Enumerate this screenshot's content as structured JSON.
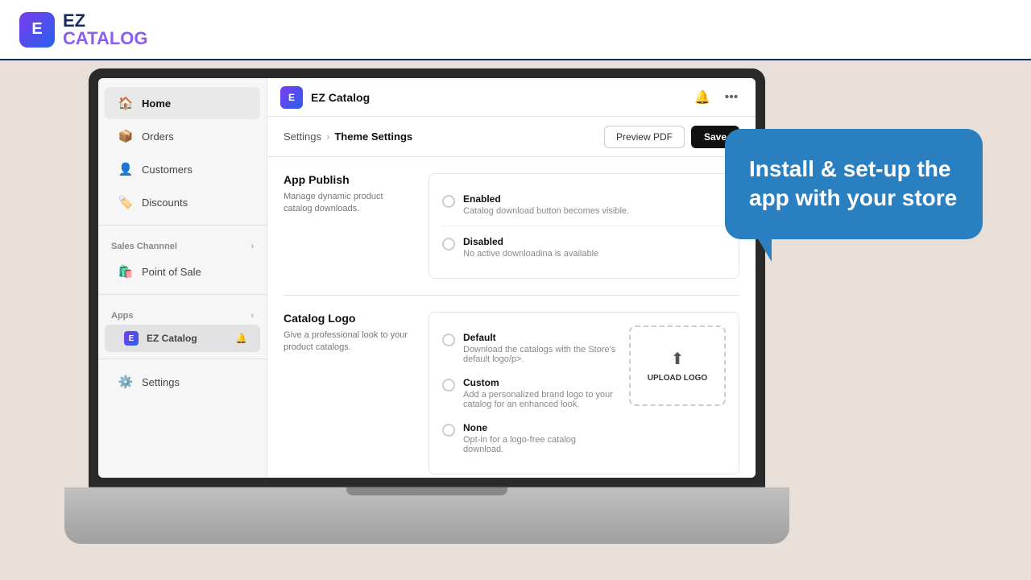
{
  "brand": {
    "ez_text": "EZ",
    "catalog_text": "CATALOG",
    "icon_letter": "E"
  },
  "top_bar_line": true,
  "sidebar": {
    "items": [
      {
        "id": "home",
        "label": "Home",
        "icon": "🏠",
        "active": true
      },
      {
        "id": "orders",
        "label": "Orders",
        "icon": "📋"
      },
      {
        "id": "customers",
        "label": "Customers",
        "icon": "👤"
      },
      {
        "id": "discounts",
        "label": "Discounts",
        "icon": "⚙️"
      }
    ],
    "sales_channel_label": "Sales Channnel",
    "sales_channel_items": [
      {
        "id": "pos",
        "label": "Point of Sale",
        "icon": "🛍️"
      }
    ],
    "apps_label": "Apps",
    "apps_sub_items": [
      {
        "id": "ez-catalog",
        "label": "EZ Catalog",
        "active": true
      }
    ],
    "settings_label": "Settings"
  },
  "app_header": {
    "logo_letter": "E",
    "title": "EZ Catalog",
    "bell_icon": "🔔",
    "more_icon": "⋯"
  },
  "breadcrumb": {
    "root": "Settings",
    "separator": "›",
    "current": "Theme Settings"
  },
  "page_actions": {
    "preview_label": "Preview PDF",
    "save_label": "Save"
  },
  "sections": {
    "app_publish": {
      "title": "App Publish",
      "description": "Manage dynamic product catalog downloads.",
      "options": [
        {
          "id": "enabled",
          "label": "Enabled",
          "description": "Catalog download button becomes visible."
        },
        {
          "id": "disabled",
          "label": "Disabled",
          "description": "No active downloadina is available"
        }
      ]
    },
    "catalog_logo": {
      "title": "Catalog Logo",
      "description": "Give a professional look to your product catalogs.",
      "options": [
        {
          "id": "default",
          "label": "Default",
          "description": "Download the catalogs with the Store's default logo/p>."
        },
        {
          "id": "custom",
          "label": "Custom",
          "description": "Add a personalized brand logo to your catalog for an enhanced look."
        },
        {
          "id": "none",
          "label": "None",
          "description": "Opt-in for a logo-free catalog download."
        }
      ],
      "upload_label": "UPLOAD LOGO"
    }
  },
  "speech_bubble": {
    "text": "Install & set-up the app with your store"
  }
}
